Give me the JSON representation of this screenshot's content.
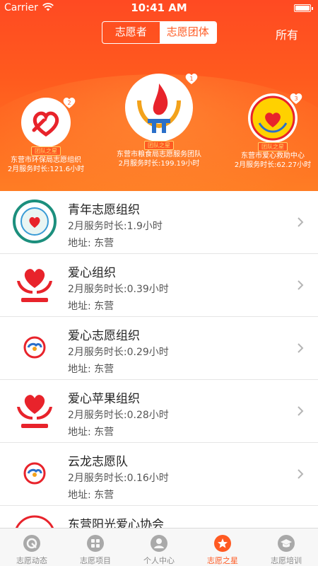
{
  "status": {
    "carrier": "Carrier",
    "time": "10:41 AM"
  },
  "segment": {
    "options": [
      "志愿者",
      "志愿团体"
    ],
    "selected": "志愿团体"
  },
  "filter_label": "所有",
  "stars": [
    {
      "rank": "2",
      "badge": "团队之星",
      "name": "东营市环保局志愿组织",
      "hours": "2月服务时长:121.6小时"
    },
    {
      "rank": "1",
      "badge": "团队之星",
      "name": "东营市粮食局志愿服务团队",
      "hours": "2月服务时长:199.19小时"
    },
    {
      "rank": "3",
      "badge": "团队之星",
      "name": "东营市爱心救助中心",
      "hours": "2月服务时长:62.27小时"
    }
  ],
  "orgs": [
    {
      "name": "青年志愿组织",
      "hours": "2月服务时长:1.9小时",
      "address": "地址: 东营"
    },
    {
      "name": "爱心组织",
      "hours": "2月服务时长:0.39小时",
      "address": "地址: 东营"
    },
    {
      "name": "爱心志愿组织",
      "hours": "2月服务时长:0.29小时",
      "address": "地址: 东营"
    },
    {
      "name": "爱心苹果组织",
      "hours": "2月服务时长:0.28小时",
      "address": "地址: 东营"
    },
    {
      "name": "云龙志愿队",
      "hours": "2月服务时长:0.16小时",
      "address": "地址: 东营"
    },
    {
      "name": "东营阳光爱心协会",
      "hours": "",
      "address": ""
    }
  ],
  "tabs": [
    {
      "label": "志愿动态",
      "icon": "news-icon"
    },
    {
      "label": "志愿项目",
      "icon": "grid-icon"
    },
    {
      "label": "个人中心",
      "icon": "person-icon"
    },
    {
      "label": "志愿之星",
      "icon": "star-icon"
    },
    {
      "label": "志愿培训",
      "icon": "graduation-cap-icon"
    }
  ],
  "active_tab": "志愿之星",
  "colors": {
    "accent": "#ff5a22",
    "heart": "#e8232b",
    "gold": "#ffd36b"
  }
}
